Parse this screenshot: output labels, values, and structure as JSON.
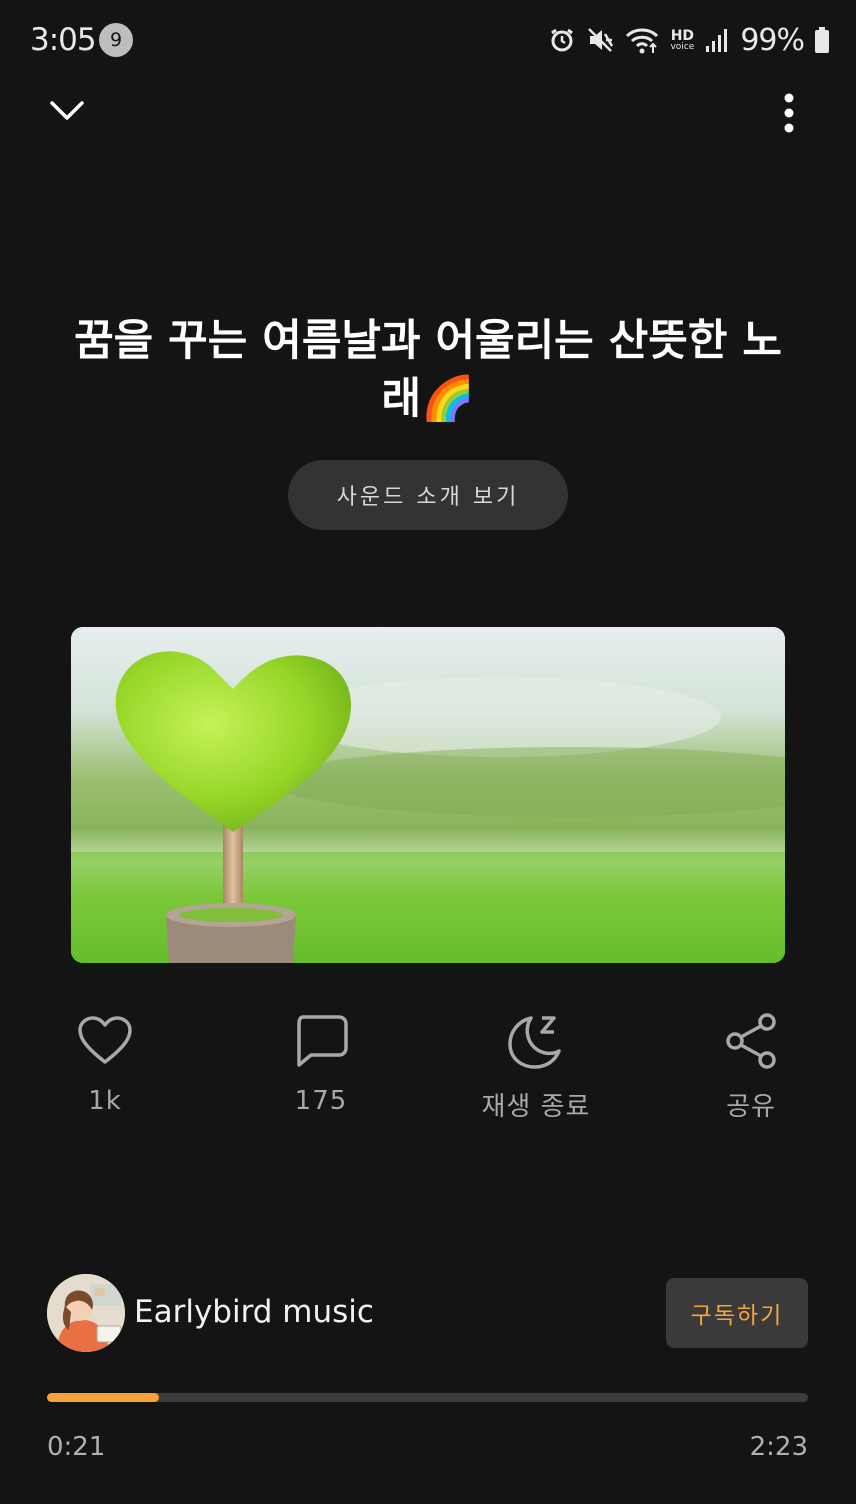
{
  "status_bar": {
    "time": "3:05",
    "notification_count": "9",
    "network_label_top": "HD",
    "network_label_bottom": "voice",
    "battery": "99%",
    "icons": [
      "alarm-icon",
      "mute-icon",
      "wifi-icon",
      "hd-voice-icon",
      "signal-icon",
      "battery-icon"
    ]
  },
  "top_bar": {
    "left_icon": "chevron-down-icon",
    "right_icon": "more-vertical-icon"
  },
  "sound": {
    "title": "꿈을 꾸는 여름날과 어울리는 산뜻한 노래🌈",
    "intro_button": "사운드 소개 보기"
  },
  "actions": [
    {
      "icon": "heart-icon",
      "label": "1k"
    },
    {
      "icon": "comment-icon",
      "label": "175"
    },
    {
      "icon": "sleep-timer-icon",
      "label": "재생 종료"
    },
    {
      "icon": "share-icon",
      "label": "공유"
    }
  ],
  "channel": {
    "name": "Earlybird music",
    "subscribe_label": "구독하기"
  },
  "player": {
    "current_time": "0:21",
    "total_time": "2:23",
    "progress_fraction": 0.147
  },
  "colors": {
    "background": "#141414",
    "accent": "#f6a13a",
    "button_bg": "#333333"
  }
}
